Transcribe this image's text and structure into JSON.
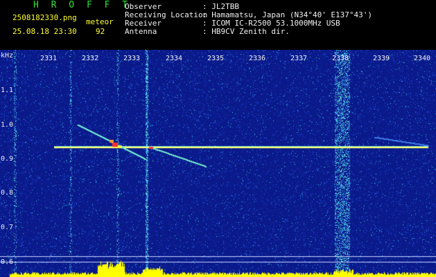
{
  "header": {
    "app_name": "H R O F F T",
    "filename": "2508182330.png",
    "mode_label": "meteor",
    "datetime": "25.08.18 23:30",
    "count": "92",
    "info_labels": [
      "Observer",
      "Receiving Location",
      "Receiver",
      "Antenna"
    ],
    "info_values": [
      ": JL2TBB",
      ": Hamamatsu, Japan (N34°40' E137°43')",
      ": ICOM IC-R2500 53.1000MHz USB",
      ": HB9CV Zenith dir."
    ]
  },
  "spectrogram": {
    "y_unit": "kHz",
    "y_ticks": [
      "1.1",
      "1.0",
      "0.9",
      "0.8",
      "0.7",
      "0.6"
    ],
    "x_ticks": [
      "2331",
      "2332",
      "2333",
      "2334",
      "2335",
      "2336",
      "2337",
      "2338",
      "2339",
      "2340"
    ],
    "colors": {
      "background": "#0a1a8a",
      "carrier": "#ffff66",
      "baseline": "#ffff00"
    }
  }
}
